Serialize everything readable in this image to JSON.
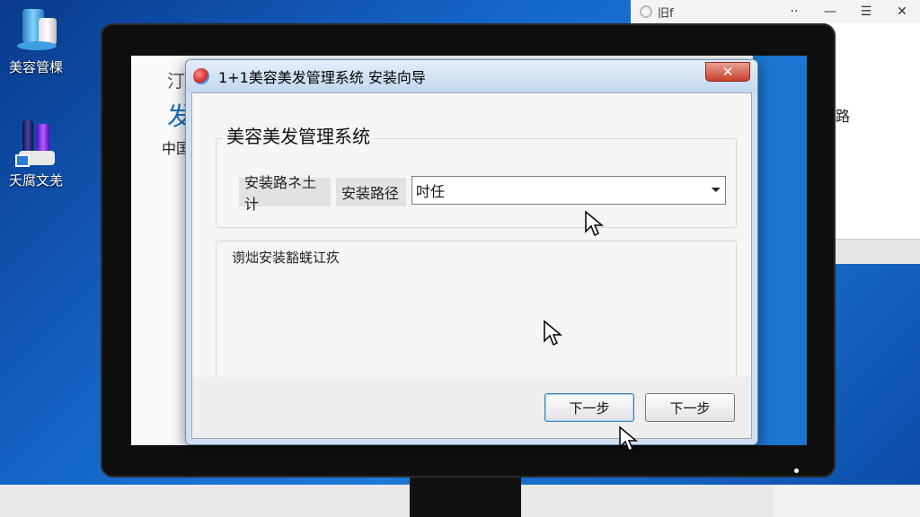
{
  "desktop": {
    "icons": [
      {
        "label": "美容管棵",
        "icon": "beauty-products-icon"
      },
      {
        "label": "夭腐文羌",
        "icon": "cosmetics-icon"
      }
    ]
  },
  "browser": {
    "tab_title": "旧f",
    "controls": [
      "··",
      "—",
      "☰",
      "✕"
    ],
    "side_text": "路"
  },
  "background_screen": {
    "line1": "汀",
    "line2": "发",
    "line3": "中国"
  },
  "dialog": {
    "title": "1+1美容美发管理系统 安装向导",
    "close_label": "✕",
    "section_title": "美容美发管理系统",
    "label_a": "安装路ネ土计",
    "label_b": "安装路径",
    "combo_value": "吋任",
    "combo_arrow": "⏷",
    "description": "谫炪安装豁蜣讧疚",
    "buttons": {
      "next": "下一步",
      "second": "下一步"
    }
  },
  "colors": {
    "desktop_blue": "#1565c8",
    "dialog_frame": "#cfe0f3",
    "close_red": "#c8412b",
    "default_button_border": "#3c7fb1"
  }
}
